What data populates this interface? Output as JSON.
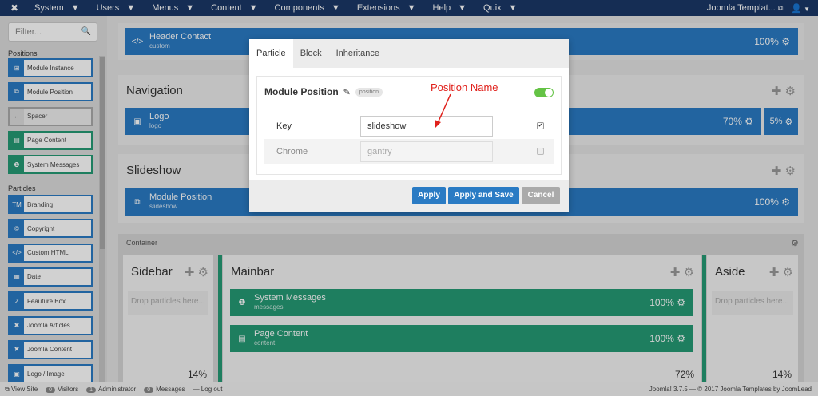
{
  "topbar": {
    "menus": [
      "System",
      "Users",
      "Menus",
      "Content",
      "Components",
      "Extensions",
      "Help",
      "Quix"
    ],
    "site_link": "Joomla Templat..."
  },
  "sidebar": {
    "filter_placeholder": "Filter...",
    "positions_label": "Positions",
    "positions": [
      {
        "label": "Module Instance",
        "icon": "module-instance-icon",
        "style": "blue"
      },
      {
        "label": "Module Position",
        "icon": "module-position-icon",
        "style": "blue"
      },
      {
        "label": "Spacer",
        "icon": "spacer-icon",
        "style": "grey"
      },
      {
        "label": "Page Content",
        "icon": "page-content-icon",
        "style": "green"
      },
      {
        "label": "System Messages",
        "icon": "system-messages-icon",
        "style": "green"
      }
    ],
    "particles_label": "Particles",
    "particles": [
      {
        "label": "Branding",
        "icon": "tm-icon"
      },
      {
        "label": "Copyright",
        "icon": "copyright-icon"
      },
      {
        "label": "Custom HTML",
        "icon": "code-icon"
      },
      {
        "label": "Date",
        "icon": "calendar-icon"
      },
      {
        "label": "Feauture Box",
        "icon": "rocket-icon"
      },
      {
        "label": "Joomla Articles",
        "icon": "joomla-icon"
      },
      {
        "label": "Joomla Content",
        "icon": "joomla-icon"
      },
      {
        "label": "Logo / Image",
        "icon": "image-icon"
      }
    ]
  },
  "main": {
    "header_bar": {
      "title": "Header Contact",
      "sub": "custom",
      "pct": "100%"
    },
    "navigation": {
      "title": "Navigation",
      "bar": {
        "title": "Logo",
        "sub": "logo",
        "pct": "70%"
      },
      "side_pct": "5%"
    },
    "slideshow": {
      "title": "Slideshow",
      "bar": {
        "title": "Module Position",
        "sub": "slideshow",
        "pct": "100%"
      }
    },
    "container": {
      "title": "Container",
      "sidebar": {
        "title": "Sidebar",
        "drop": "Drop particles here...",
        "pct": "14%"
      },
      "mainbar": {
        "title": "Mainbar",
        "bars": [
          {
            "title": "System Messages",
            "sub": "messages",
            "pct": "100%"
          },
          {
            "title": "Page Content",
            "sub": "content",
            "pct": "100%"
          }
        ],
        "pct": "72%"
      },
      "aside": {
        "title": "Aside",
        "drop": "Drop particles here...",
        "pct": "14%"
      }
    }
  },
  "modal": {
    "tabs": [
      "Particle",
      "Block",
      "Inheritance"
    ],
    "heading": "Module Position",
    "badge": "position",
    "key_label": "Key",
    "key_value": "slideshow",
    "chrome_label": "Chrome",
    "chrome_value": "gantry",
    "apply": "Apply",
    "apply_save": "Apply and Save",
    "cancel": "Cancel"
  },
  "annotation": "Position Name",
  "statusbar": {
    "view_site": "View Site",
    "visitors_count": "0",
    "visitors": "Visitors",
    "admin_count": "1",
    "admin": "Administrator",
    "messages_count": "0",
    "messages": "Messages",
    "logout": "Log out",
    "footer": "Joomla! 3.7.5 — © 2017 Joomla Templates by JoomLead"
  },
  "colors": {
    "navbar": "#1a3867",
    "blue": "#2a7bc4",
    "green": "#259a75",
    "annotation": "#e0201b"
  }
}
